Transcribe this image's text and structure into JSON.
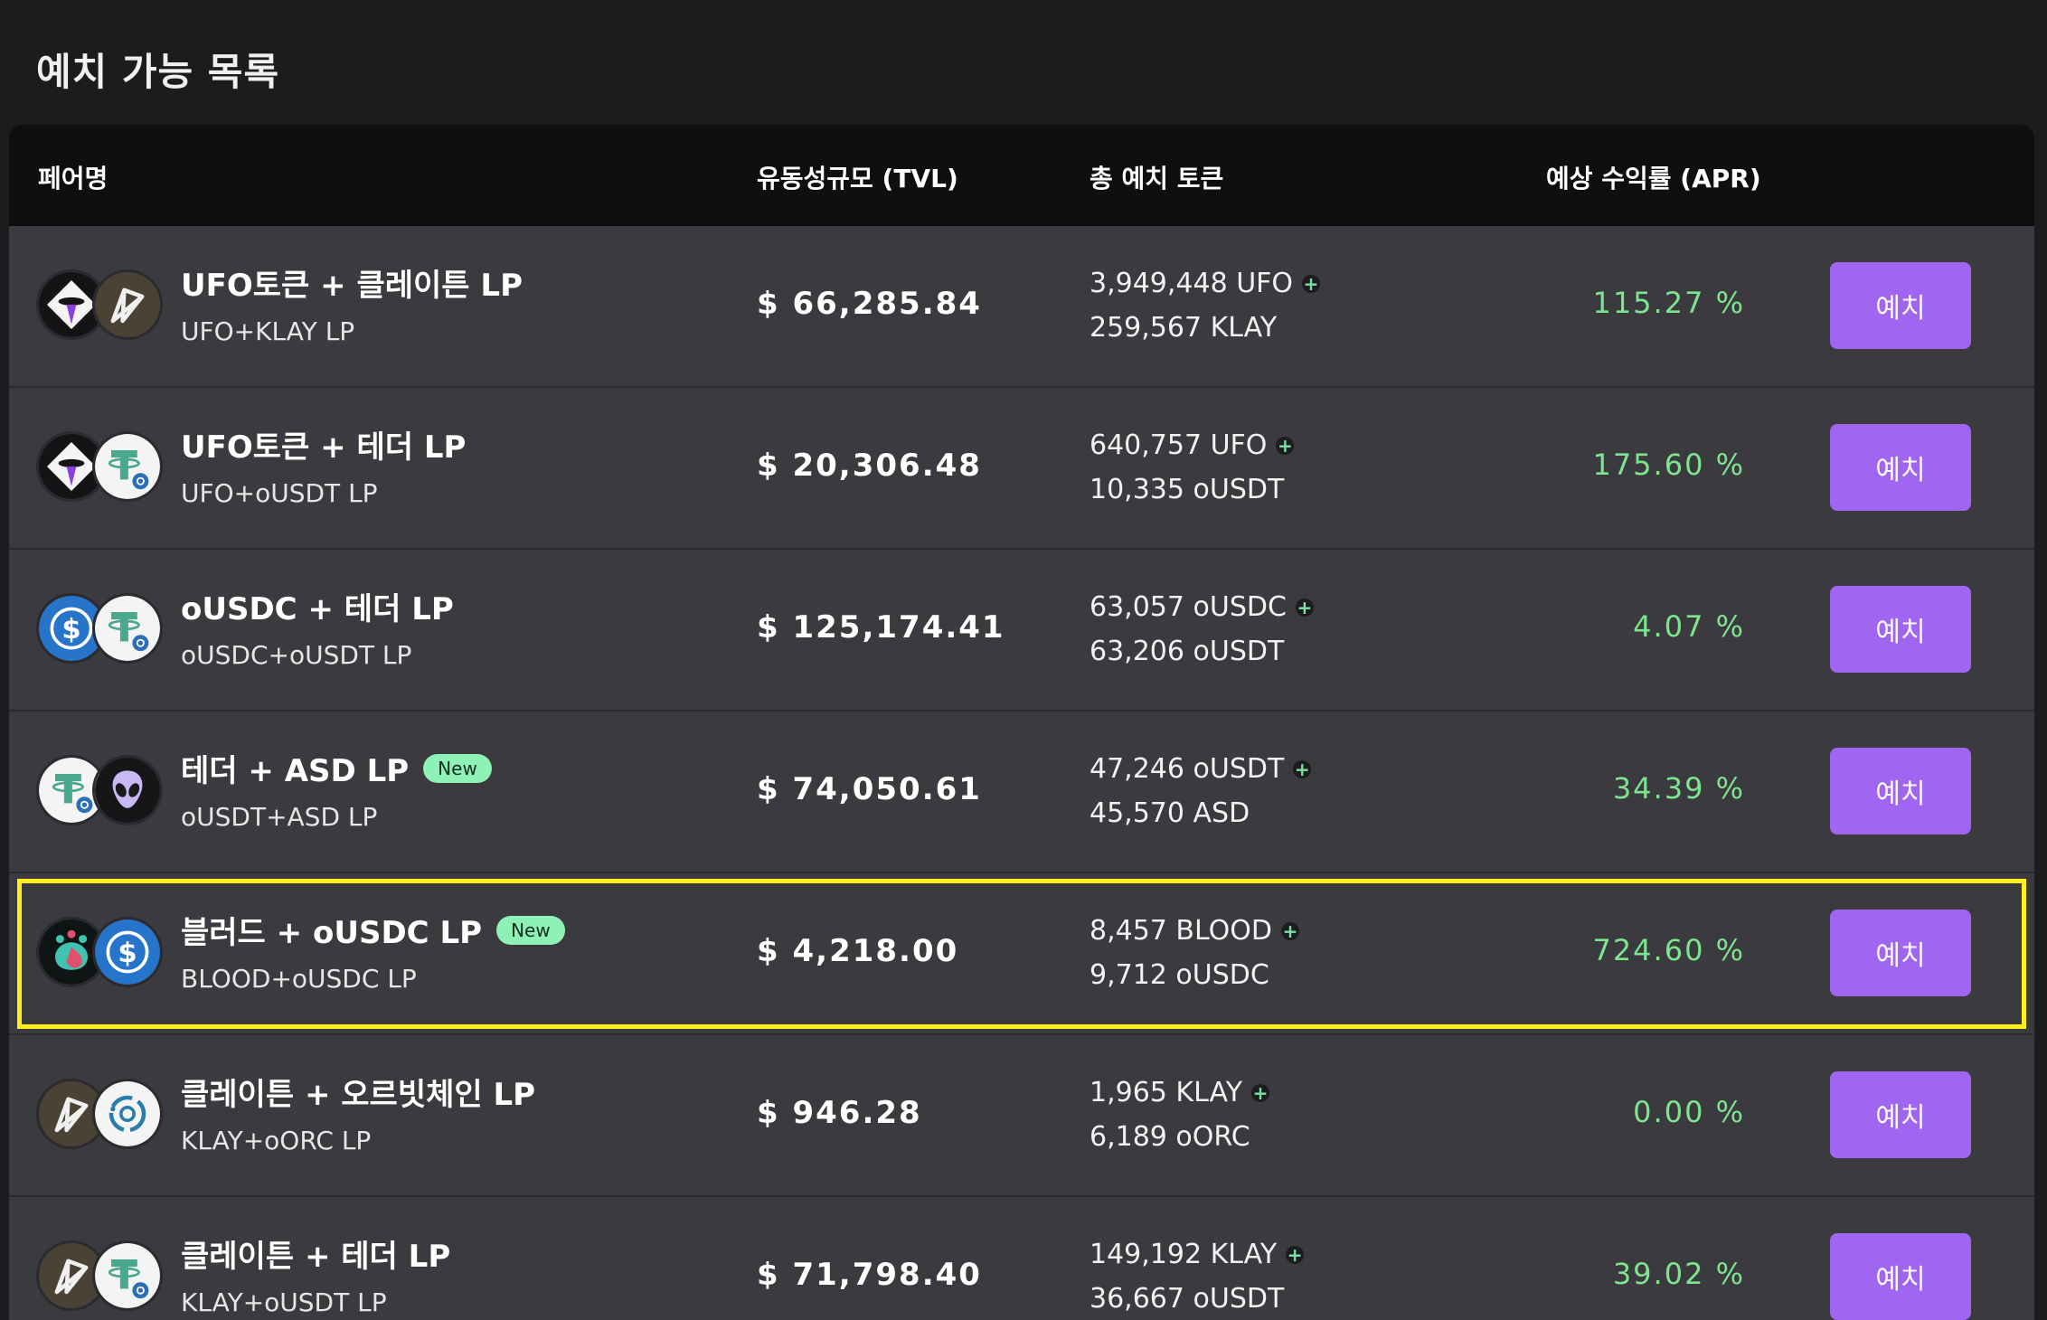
{
  "page": {
    "title": "예치 가능 목록"
  },
  "header": {
    "pair": "페어명",
    "tvl": "유동성규모 (TVL)",
    "total": "총 예치 토큰",
    "apr": "예상 수익률 (APR)"
  },
  "colors": {
    "accent": "#a065f1",
    "apr_green": "#7ee48f",
    "badge": "#8ef2b6",
    "highlight": "#ffee1a"
  },
  "rows": [
    {
      "name": "UFO토큰 + 클레이튼 LP",
      "new": "",
      "sub": "UFO+KLAY LP",
      "tvl": "$ 66,285.84",
      "tok1": "3,949,448 UFO",
      "tok2": "259,567 KLAY",
      "apr": "115.27 %",
      "btn": "예치",
      "icons": [
        "ufo-token-icon",
        "klay-token-icon"
      ]
    },
    {
      "name": "UFO토큰 + 테더 LP",
      "new": "",
      "sub": "UFO+oUSDT LP",
      "tvl": "$ 20,306.48",
      "tok1": "640,757 UFO",
      "tok2": "10,335 oUSDT",
      "apr": "175.60 %",
      "btn": "예치",
      "icons": [
        "ufo-token-icon",
        "tether-token-icon"
      ]
    },
    {
      "name": "oUSDC + 테더 LP",
      "new": "",
      "sub": "oUSDC+oUSDT LP",
      "tvl": "$ 125,174.41",
      "tok1": "63,057 oUSDC",
      "tok2": "63,206 oUSDT",
      "apr": "4.07 %",
      "btn": "예치",
      "icons": [
        "usdc-token-icon",
        "tether-token-icon"
      ]
    },
    {
      "name": "테더 + ASD LP",
      "new": "New",
      "sub": "oUSDT+ASD LP",
      "tvl": "$ 74,050.61",
      "tok1": "47,246 oUSDT",
      "tok2": "45,570 ASD",
      "apr": "34.39 %",
      "btn": "예치",
      "icons": [
        "tether-token-icon",
        "asd-alien-icon"
      ]
    },
    {
      "name": "블러드 + oUSDC LP",
      "new": "New",
      "sub": "BLOOD+oUSDC LP",
      "tvl": "$ 4,218.00",
      "tok1": "8,457 BLOOD",
      "tok2": "9,712 oUSDC",
      "apr": "724.60 %",
      "btn": "예치",
      "icons": [
        "blood-token-icon",
        "usdc-token-icon"
      ]
    },
    {
      "name": "클레이튼 + 오르빗체인 LP",
      "new": "",
      "sub": "KLAY+oORC LP",
      "tvl": "$ 946.28",
      "tok1": "1,965 KLAY",
      "tok2": "6,189 oORC",
      "apr": "0.00 %",
      "btn": "예치",
      "icons": [
        "klay-token-icon",
        "orbit-chain-icon"
      ]
    },
    {
      "name": "클레이튼 + 테더 LP",
      "new": "",
      "sub": "KLAY+oUSDT LP",
      "tvl": "$ 71,798.40",
      "tok1": "149,192 KLAY",
      "tok2": "36,667 oUSDT",
      "apr": "39.02 %",
      "btn": "예치",
      "icons": [
        "klay-token-icon",
        "tether-token-icon"
      ]
    }
  ]
}
